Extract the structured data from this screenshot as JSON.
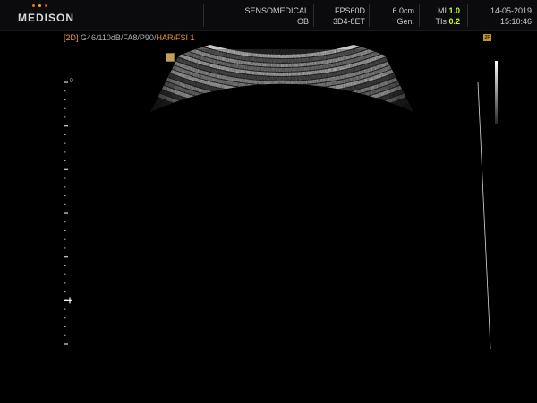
{
  "header": {
    "brand": "MEDISON",
    "brand_dot_colors": [
      "#f26a2a",
      "#f5a623",
      "#e33a2a"
    ],
    "hospital": "SENSOMEDICAL",
    "application": "OB",
    "probe": "FPS60D",
    "preset": "3D4-8ET",
    "depth": "6.0cm",
    "frequency": "Gen.",
    "mi_label": "MI",
    "mi_value": "1.0",
    "tis_label": "TIs",
    "tis_value": "0.2",
    "date": "14-05-2019",
    "time": "15:10:46"
  },
  "params": {
    "mode": "[2D]",
    "settings": "G46/110dB/FA8/P90/",
    "harmonic": "HAR/FSI 1"
  },
  "depth_scale": {
    "zero_label": "0"
  },
  "focus_badge_label": "2F",
  "colors": {
    "accent": "#f09a32",
    "value_highlight": "#c8ff3a",
    "background": "#000000"
  }
}
